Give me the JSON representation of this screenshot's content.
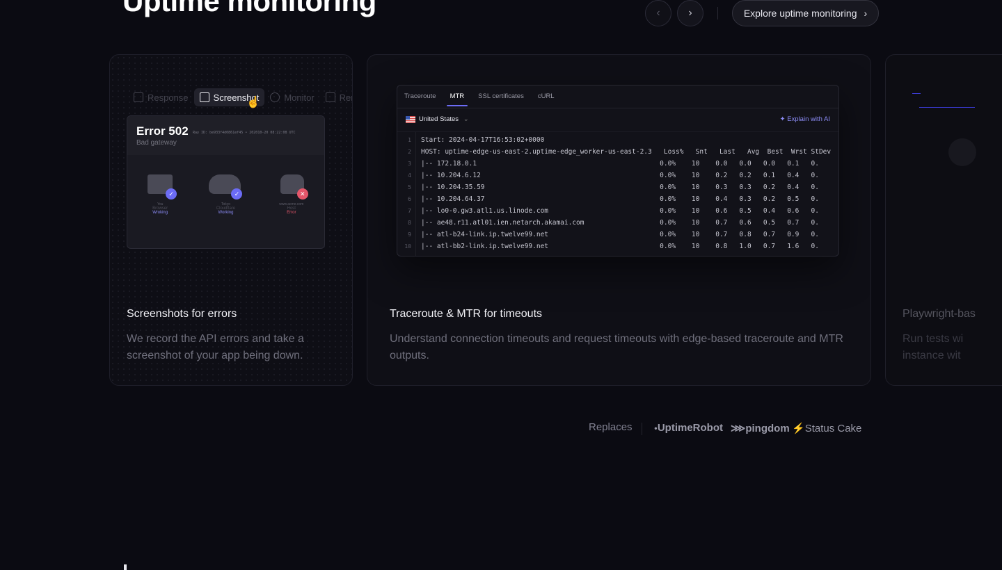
{
  "header": {
    "title": "Uptime monitoring",
    "prev_icon": "chevron-left-icon",
    "next_icon": "chevron-right-icon",
    "explore_label": "Explore uptime monitoring"
  },
  "cards": [
    {
      "title": "Screenshots for errors",
      "description": "We record the API errors and take a screenshot of your app being down.",
      "tabs": [
        "Response",
        "Screenshot",
        "Monitor",
        "Rem"
      ],
      "active_tab": "Screenshot",
      "error": {
        "code": "Error 502",
        "subtitle": "Bad gateway",
        "ray": "Ray ID: be933f4d0861ef45 • 202010-20 08:22:08 UTC",
        "steps": [
          {
            "location": "You",
            "name": "Browser",
            "status": "Wroking",
            "state": "ok"
          },
          {
            "location": "Tokyo",
            "name": "Cloudflare",
            "status": "Working",
            "state": "ok"
          },
          {
            "location": "www.acme.com",
            "name": "Host",
            "status": "Error",
            "state": "error"
          }
        ]
      }
    },
    {
      "title": "Traceroute & MTR for timeouts",
      "description": "Understand connection timeouts and request timeouts with edge-based traceroute and MTR outputs.",
      "terminal": {
        "tabs": [
          "Traceroute",
          "MTR",
          "SSL certificates",
          "cURL"
        ],
        "active_tab": "MTR",
        "country": "United States",
        "ai_label": "Explain with AI",
        "lines": [
          "Start: 2024-04-17T16:53:02+0000",
          "HOST: uptime-edge-us-east-2.uptime-edge_worker-us-east-2.3   Loss%   Snt   Last   Avg  Best  Wrst StDev",
          "|-- 172.18.0.1                                              0.0%    10    0.0   0.0   0.0   0.1   0.",
          "|-- 10.204.6.12                                             0.0%    10    0.2   0.2   0.1   0.4   0.",
          "|-- 10.204.35.59                                            0.0%    10    0.3   0.3   0.2   0.4   0.",
          "|-- 10.204.64.37                                            0.0%    10    0.4   0.3   0.2   0.5   0.",
          "|-- lo0-0.gw3.atl1.us.linode.com                            0.0%    10    0.6   0.5   0.4   0.6   0.",
          "|-- ae48.r11.atl01.ien.netarch.akamai.com                   0.0%    10    0.7   0.6   0.5   0.7   0.",
          "|-- atl-b24-link.ip.twelve99.net                            0.0%    10    0.7   0.8   0.7   0.9   0.",
          "|-- atl-bb2-link.ip.twelve99.net                            0.0%    10    0.8   1.0   0.7   1.6   0."
        ]
      }
    },
    {
      "title": "Playwright-bas",
      "description": "Run tests wi instance wit"
    }
  ],
  "replaces": {
    "label": "Replaces",
    "logos": [
      "UptimeRobot",
      "pingdom",
      "Status Cake"
    ]
  },
  "colors": {
    "background": "#0b0b12",
    "accent": "#6c6cf5",
    "error": "#e5566a"
  }
}
